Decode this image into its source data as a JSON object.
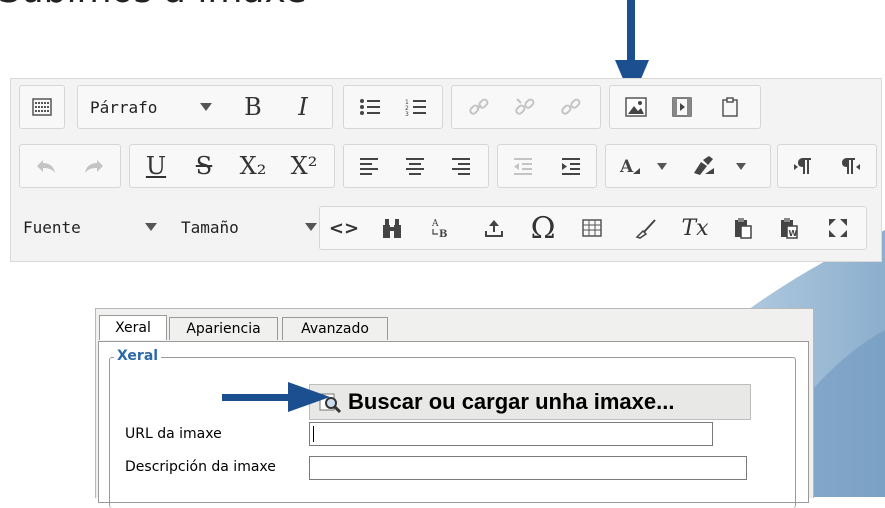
{
  "heading": "Subimos a imaxe",
  "toolbar": {
    "format_combo": "Párrafo",
    "bold": "B",
    "italic": "I",
    "underline": "U",
    "strike": "S",
    "subscript": "X₂",
    "superscript": "X²",
    "font_combo": "Fuente",
    "size_combo": "Tamaño",
    "source": "<>",
    "special_char": "Ω",
    "clear_format": "Tx"
  },
  "dialog": {
    "tabs": [
      "Xeral",
      "Apariencia",
      "Avanzado"
    ],
    "legend": "Xeral",
    "browse_button": "Buscar ou cargar unha imaxe...",
    "url_label": "URL da imaxe",
    "url_value": "",
    "desc_label": "Descripción da imaxe",
    "desc_value": ""
  },
  "colors": {
    "arrow": "#1c4f8f",
    "legend": "#2b6aa6",
    "background_shape": "#7fa6c8"
  }
}
